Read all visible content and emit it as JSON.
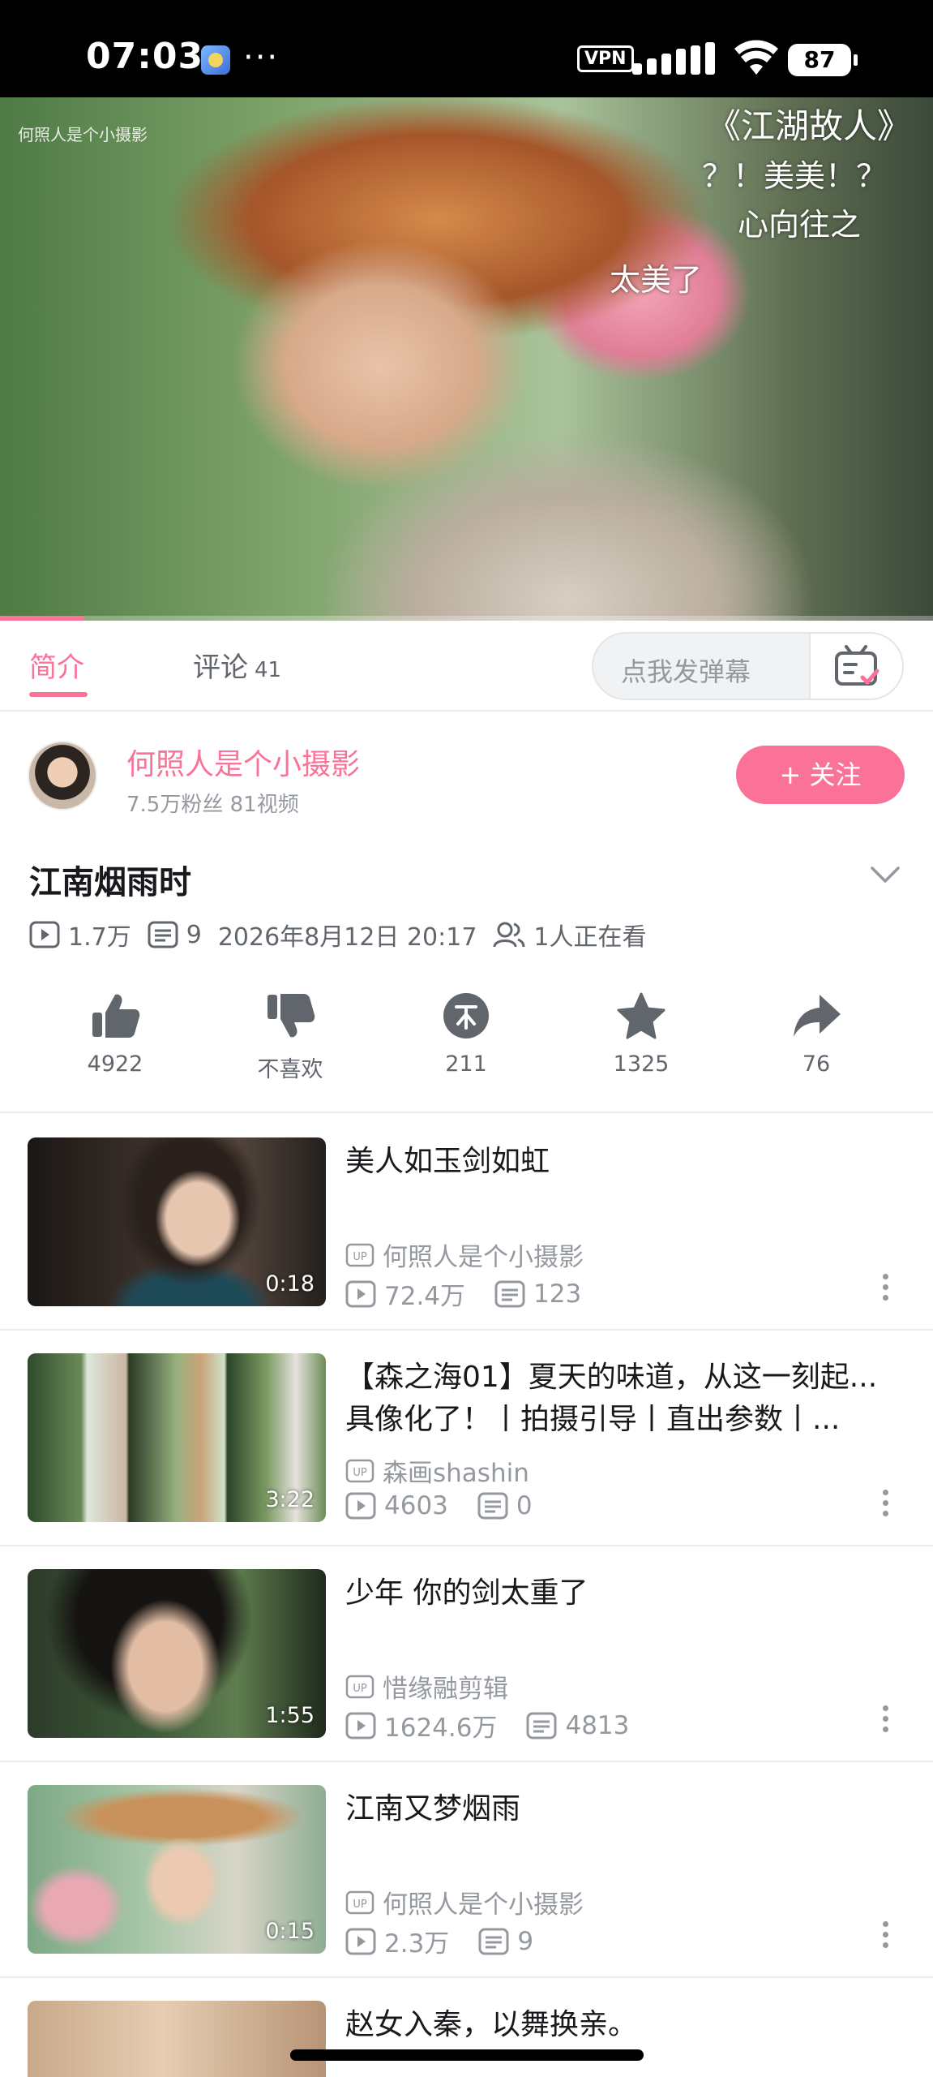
{
  "status_bar": {
    "time": "07:03",
    "dots": "···",
    "vpn": "VPN",
    "battery": "87",
    "icons": [
      "app-icon",
      "vpn-icon",
      "signal-icon",
      "wifi-icon",
      "battery-icon"
    ]
  },
  "video": {
    "watermark": "何照人是个小摄影",
    "danmaku": [
      "《江湖故人》",
      "？！美美！？",
      "心向往之",
      "太美了"
    ],
    "progress": 0.09
  },
  "tabs": {
    "intro": "简介",
    "comments": "评论",
    "comments_count": "41",
    "danmaku_placeholder": "点我发弹幕",
    "danmaku_icon": "danmaku-settings-icon"
  },
  "uploader": {
    "name": "何照人是个小摄影",
    "stats": "7.5万粉丝   81视频",
    "follow": "+ 关注"
  },
  "video_info": {
    "title": "江南烟雨时",
    "views": "1.7万",
    "danmaku_count": "9",
    "date": "2026年8月12日 20:17",
    "watching": "1人正在看"
  },
  "actions": [
    {
      "icon": "like-icon",
      "label": "4922"
    },
    {
      "icon": "dislike-icon",
      "label": "不喜欢"
    },
    {
      "icon": "coin-icon",
      "label": "211"
    },
    {
      "icon": "favorite-icon",
      "label": "1325"
    },
    {
      "icon": "share-icon",
      "label": "76"
    }
  ],
  "recommendations": [
    {
      "title": "美人如玉剑如虹",
      "duration": "0:18",
      "uploader": "何照人是个小摄影",
      "views": "72.4万",
      "danmaku": "123"
    },
    {
      "title": "【森之海01】夏天的味道，从这一刻起...具像化了！丨拍摄引导丨直出参数丨...",
      "duration": "3:22",
      "uploader": "森画shashin",
      "views": "4603",
      "danmaku": "0"
    },
    {
      "title": "少年 你的剑太重了",
      "duration": "1:55",
      "uploader": "惜缘融剪辑",
      "views": "1624.6万",
      "danmaku": "4813"
    },
    {
      "title": "江南又梦烟雨",
      "duration": "0:15",
      "uploader": "何照人是个小摄影",
      "views": "2.3万",
      "danmaku": "9"
    },
    {
      "title": "赵女入秦，以舞换亲。",
      "duration": "",
      "uploader": "",
      "views": "",
      "danmaku": ""
    }
  ],
  "colors": {
    "accent": "#fb7299",
    "text_secondary": "#9499a0"
  }
}
